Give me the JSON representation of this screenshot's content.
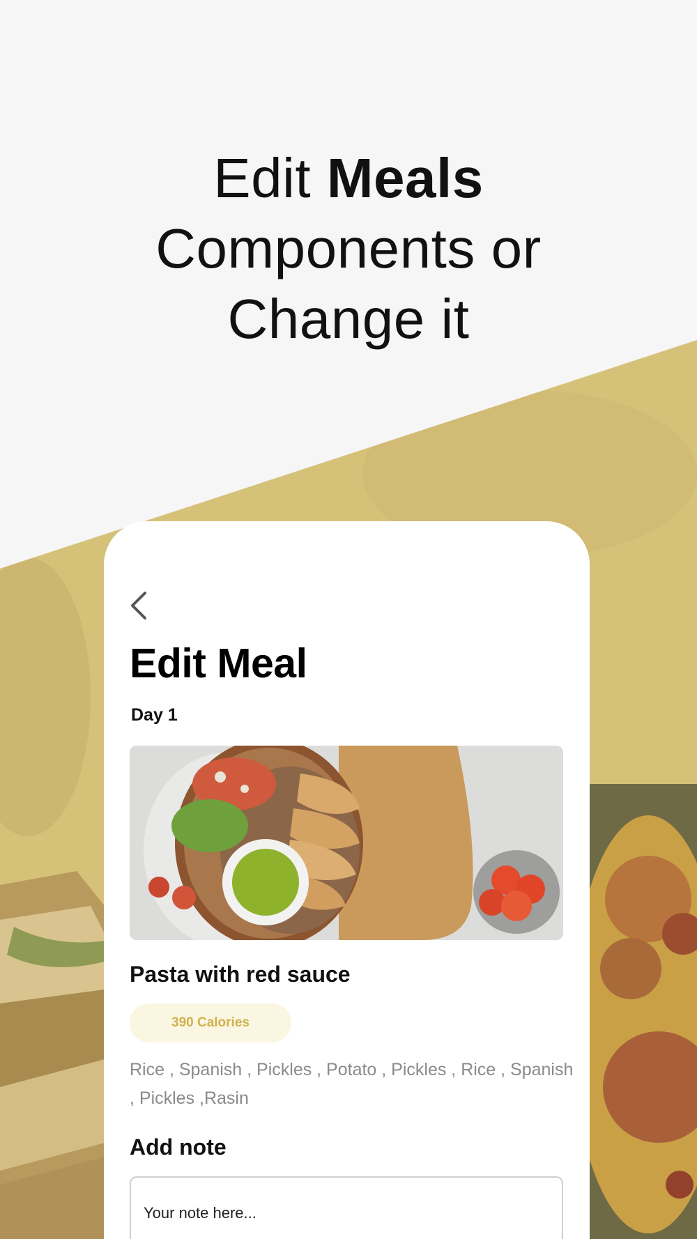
{
  "headline": {
    "word1": "Edit",
    "word2": "Meals",
    "line2": "Components or",
    "line3": "Change it"
  },
  "screen": {
    "title": "Edit Meal",
    "day_label": "Day 1",
    "back_icon": "chevron-left-icon",
    "meal": {
      "name": "Pasta with red sauce",
      "calories": "390 Calories",
      "ingredients": "Rice , Spanish , Pickles , Potato , Pickles , Rice , Spanish , Pickles ,Rasin"
    },
    "note": {
      "heading": "Add note",
      "placeholder": "Your note here..."
    }
  },
  "colors": {
    "page_bg": "#f6f6f6",
    "accent_band": "#d6c179",
    "calorie_badge_bg": "#fbf6e2",
    "calorie_text": "#cfb24f",
    "muted_text": "#8a8a8a"
  }
}
